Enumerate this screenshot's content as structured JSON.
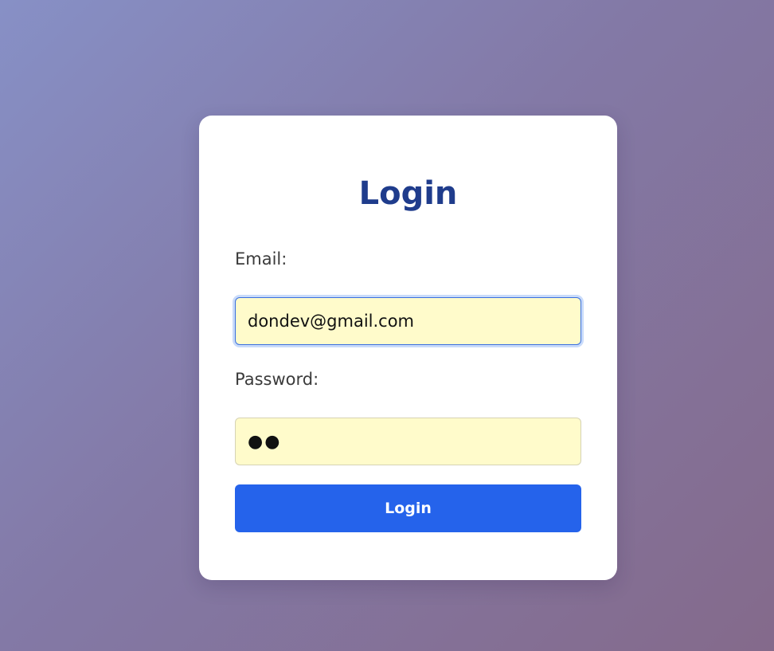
{
  "form": {
    "title": "Login",
    "email_label": "Email:",
    "email_value": "dondev@gmail.com",
    "password_label": "Password:",
    "password_masked": "●●",
    "submit_label": "Login"
  },
  "colors": {
    "title": "#1f3c8c",
    "button": "#2563eb",
    "field_background": "#fffbcb",
    "focus_ring": "#c9dbfa"
  }
}
